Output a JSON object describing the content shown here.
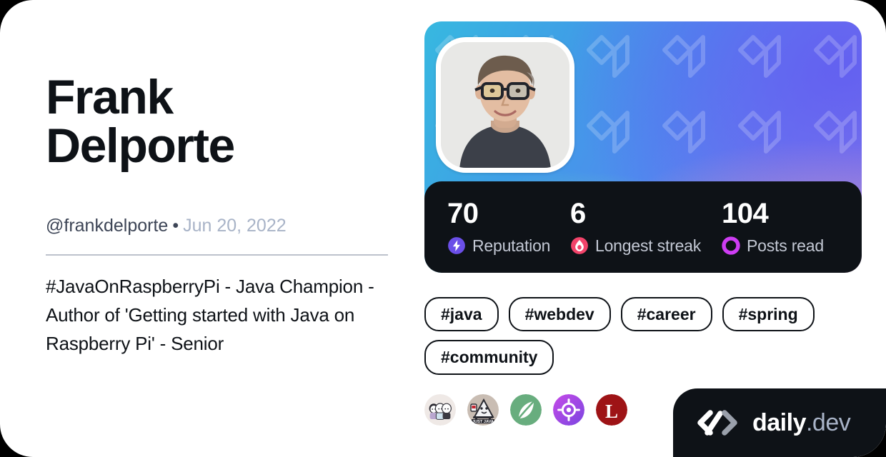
{
  "card": {
    "background_color": "#ffffff",
    "page_background": "#000000"
  },
  "profile": {
    "name": "Frank Delporte",
    "handle": "@frankdelporte",
    "separator": "•",
    "joined_date": "Jun 20, 2022",
    "bio": "#JavaOnRaspberryPi - Java Champion - Author of 'Getting started with Java on Raspberry Pi' - Senior",
    "avatar_alt": "frank-delporte-avatar"
  },
  "stats": [
    {
      "value": "70",
      "label": "Reputation",
      "icon": "reputation-bolt-icon",
      "color": "#6B4FE8"
    },
    {
      "value": "6",
      "label": "Longest streak",
      "icon": "streak-flame-icon",
      "color": "#F2436A"
    },
    {
      "value": "104",
      "label": "Posts read",
      "icon": "posts-read-ring-icon",
      "color": "#CE3DF3"
    }
  ],
  "tags": [
    {
      "label": "#java"
    },
    {
      "label": "#webdev"
    },
    {
      "label": "#career"
    },
    {
      "label": "#spring"
    },
    {
      "label": "#community"
    }
  ],
  "sources": [
    {
      "name": "three-characters-source-icon"
    },
    {
      "name": "just-java-source-icon",
      "caption": "JUST JAVA"
    },
    {
      "name": "spring-leaf-source-icon"
    },
    {
      "name": "purple-target-source-icon"
    },
    {
      "name": "red-l-source-icon",
      "caption": "L"
    }
  ],
  "badge": {
    "logo_icon": "daily-dev-logo-mark",
    "brand": "daily",
    "suffix": ".dev"
  }
}
